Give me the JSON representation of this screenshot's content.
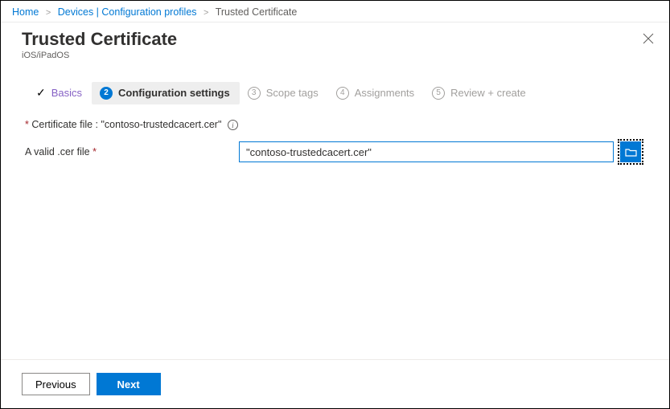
{
  "breadcrumb": {
    "home": "Home",
    "devices": "Devices | Configuration profiles",
    "current": "Trusted Certificate"
  },
  "header": {
    "title": "Trusted Certificate",
    "subtitle": "iOS/iPadOS"
  },
  "steps": {
    "basics": "Basics",
    "config": "Configuration settings",
    "scope": "Scope tags",
    "assignments": "Assignments",
    "review": "Review + create",
    "num2": "2",
    "num3": "3",
    "num4": "4",
    "num5": "5"
  },
  "form": {
    "cert_label_prefix": "Certificate file : ",
    "cert_filename": "\"contoso-trustedcacert.cer\"",
    "valid_label": "A valid .cer file",
    "input_value": "\"contoso-trustedcacert.cer\""
  },
  "footer": {
    "previous": "Previous",
    "next": "Next"
  }
}
